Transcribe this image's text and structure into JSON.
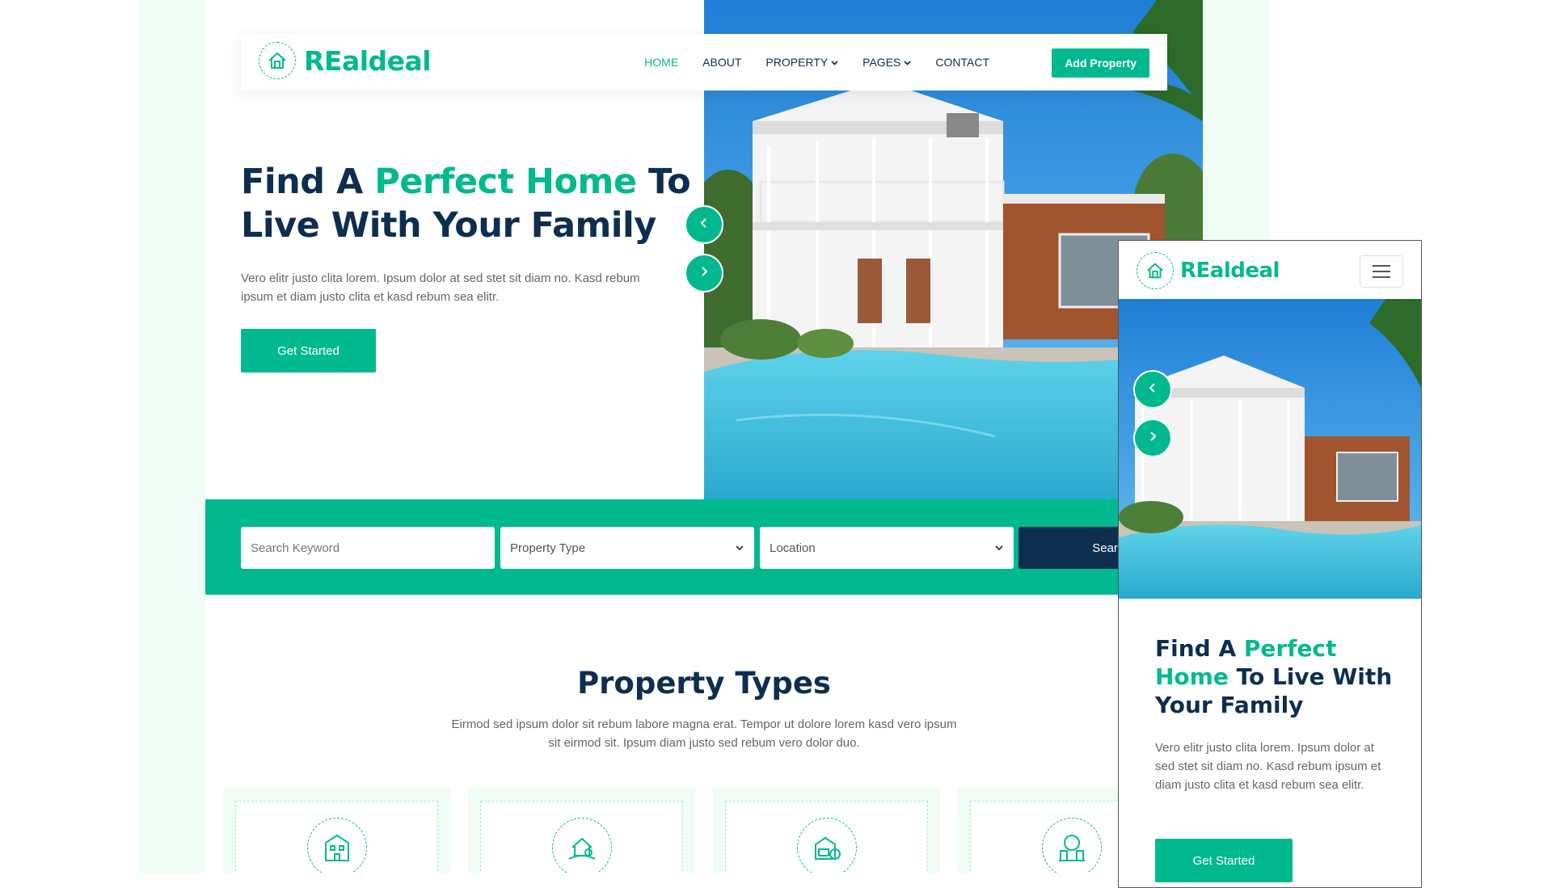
{
  "brand": {
    "name": "REaldeal"
  },
  "nav": {
    "items": [
      {
        "label": "HOME",
        "active": true,
        "dropdown": false
      },
      {
        "label": "ABOUT",
        "active": false,
        "dropdown": false
      },
      {
        "label": "PROPERTY",
        "active": false,
        "dropdown": true
      },
      {
        "label": "PAGES",
        "active": false,
        "dropdown": true
      },
      {
        "label": "CONTACT",
        "active": false,
        "dropdown": false
      }
    ],
    "cta": "Add Property"
  },
  "hero": {
    "title_part1": "Find A ",
    "title_highlight": "Perfect Home",
    "title_part2": " To Live With Your Family",
    "description": "Vero elitr justo clita lorem. Ipsum dolor at sed stet sit diam no. Kasd rebum ipsum et diam justo clita et kasd rebum sea elitr.",
    "button": "Get Started"
  },
  "search": {
    "keyword_placeholder": "Search Keyword",
    "type_selected": "Property Type",
    "location_selected": "Location",
    "button": "Search"
  },
  "property_types": {
    "title": "Property Types",
    "description": "Eirmod sed ipsum dolor sit rebum labore magna erat. Tempor ut dolore lorem kasd vero ipsum sit eirmod sit. Ipsum diam justo sed rebum vero dolor duo.",
    "icons": [
      "apartment-icon",
      "villa-icon",
      "office-icon",
      "building-icon"
    ]
  },
  "mobile": {
    "brand": "REaldeal",
    "title_part1": "Find A ",
    "title_highlight": "Perfect Home",
    "title_part2": " To Live With Your Family",
    "description": "Vero elitr justo clita lorem. Ipsum dolor at sed stet sit diam no. Kasd rebum ipsum et diam justo clita et kasd rebum sea elitr.",
    "button": "Get Started"
  },
  "colors": {
    "primary": "#00b98e",
    "dark": "#0e2e50",
    "light": "#effdf5",
    "sky": "#2e95e6",
    "pool": "#3fc4e0"
  }
}
